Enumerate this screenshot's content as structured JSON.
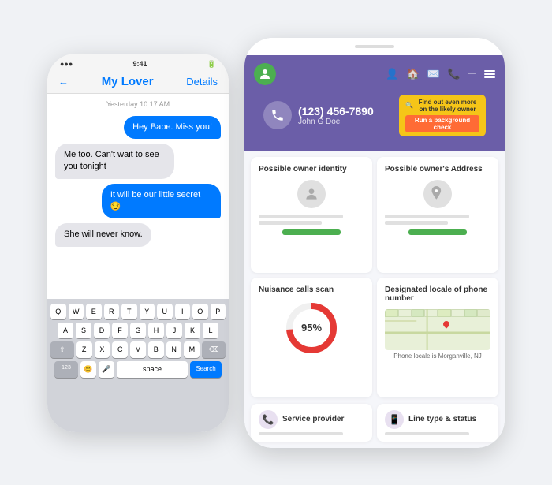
{
  "left_phone": {
    "nav": {
      "back": "←",
      "contact": "My Lover",
      "details": "Details"
    },
    "timestamp": "Yesterday 10:17 AM",
    "messages": [
      {
        "text": "Hey Babe. Miss you!",
        "type": "sent"
      },
      {
        "text": "Me too. Can't wait to see you tonight",
        "type": "received"
      },
      {
        "text": "It will be our little secret 😏",
        "type": "sent"
      },
      {
        "text": "She will never know.",
        "type": "received"
      }
    ],
    "keyboard": {
      "rows": [
        [
          "Q",
          "W",
          "E",
          "R",
          "T",
          "Y",
          "U",
          "I",
          "O",
          "P"
        ],
        [
          "A",
          "S",
          "D",
          "F",
          "G",
          "H",
          "J",
          "K",
          "L"
        ],
        [
          "⇧",
          "Z",
          "X",
          "C",
          "V",
          "B",
          "N",
          "M",
          "⌫"
        ],
        [
          "123",
          "😊",
          "🎤",
          "space",
          "Search"
        ]
      ]
    }
  },
  "right_phone": {
    "header": {
      "phone_number": "(123) 456-7890",
      "owner_name": "John G Doe",
      "cta_text": "Find out even more on the likely owner",
      "cta_button": "Run a background check"
    },
    "cards": [
      {
        "title": "Possible owner identity",
        "type": "identity"
      },
      {
        "title": "Possible owner's Address",
        "type": "address"
      },
      {
        "title": "Nuisance calls scan",
        "type": "donut",
        "value": "95%"
      },
      {
        "title": "Designated locale of phone number",
        "type": "map",
        "caption": "Phone locale is Morganville, NJ"
      }
    ],
    "bottom_cards": [
      {
        "title": "Service provider",
        "icon": "📞"
      },
      {
        "title": "Line type & status",
        "icon": "📱"
      }
    ]
  }
}
